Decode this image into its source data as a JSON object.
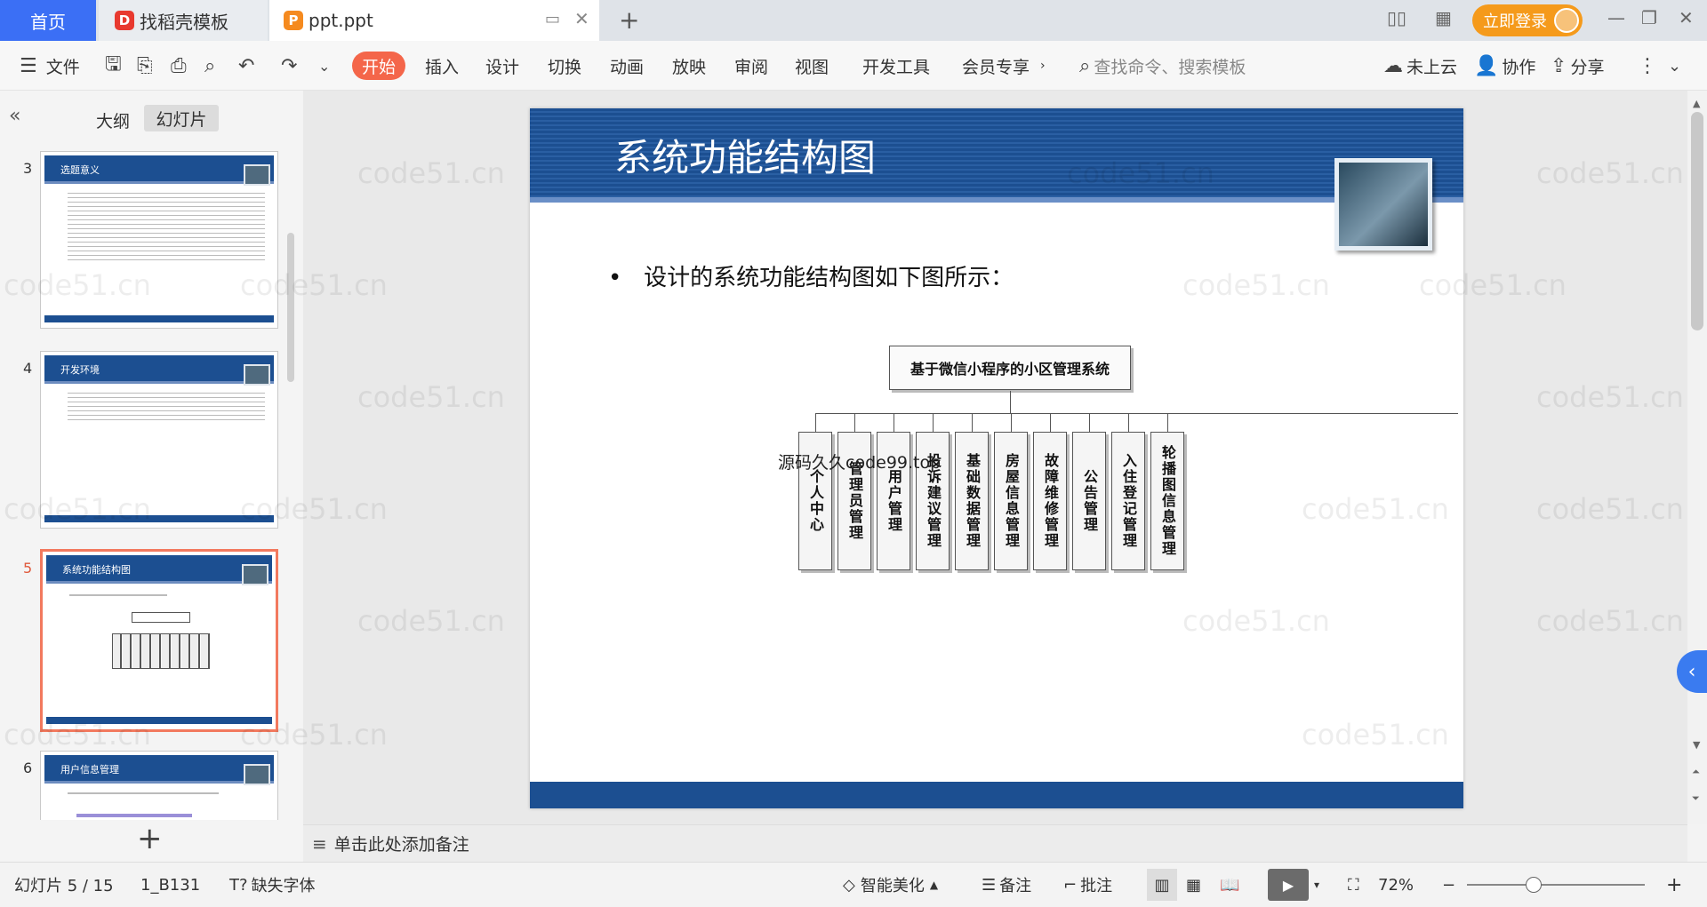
{
  "tabs": {
    "home": "首页",
    "template": "找稻壳模板",
    "file": "ppt.ppt"
  },
  "account": {
    "login": "立即登录"
  },
  "menu": {
    "file": "文件",
    "start": "开始",
    "items": [
      "插入",
      "设计",
      "切换",
      "动画",
      "放映",
      "审阅",
      "视图",
      "开发工具",
      "会员专享"
    ],
    "search_placeholder": "查找命令、搜索模板",
    "cloud": "未上云",
    "collab": "协作",
    "share": "分享"
  },
  "panel": {
    "outline": "大纲",
    "slides": "幻灯片"
  },
  "thumbnails": [
    {
      "num": "3",
      "title": "选题意义",
      "selected": false
    },
    {
      "num": "4",
      "title": "开发环境",
      "selected": false
    },
    {
      "num": "5",
      "title": "系统功能结构图",
      "selected": true
    },
    {
      "num": "6",
      "title": "用户信息管理",
      "selected": false
    }
  ],
  "slide": {
    "title": "系统功能结构图",
    "bullet": "设计的系统功能结构图如下图所示：",
    "org": {
      "root": "基于微信小程序的小区管理系统",
      "children": [
        "个人中心",
        "管理员管理",
        "用户管理",
        "投诉建议管理",
        "基础数据管理",
        "房屋信息管理",
        "故障维修管理",
        "公告管理",
        "入住登记管理",
        "轮播图信息管理"
      ]
    },
    "overlay_text": "源码久久code99.top"
  },
  "watermark": "code51.cn",
  "notes": {
    "placeholder": "单击此处添加备注"
  },
  "status": {
    "slide_count": "幻灯片 5 / 15",
    "theme": "1_B131",
    "font_warning": "缺失字体",
    "beautify": "智能美化",
    "notes": "备注",
    "comment": "批注",
    "zoom": "72%"
  }
}
